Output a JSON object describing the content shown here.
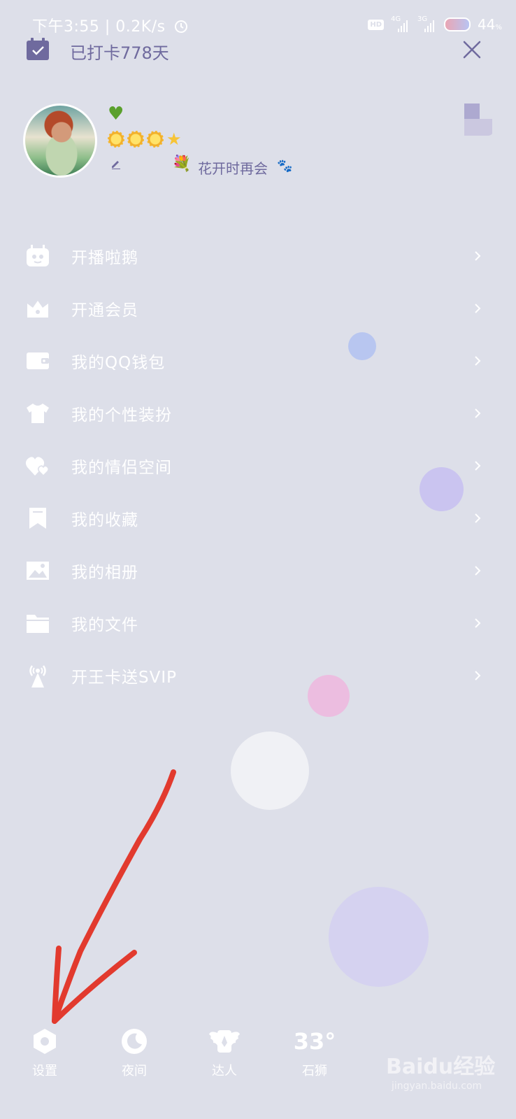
{
  "status_bar": {
    "left": "下午3:55 | 0.2K/s",
    "alarm_icon": "alarm-icon",
    "hd": "HD",
    "net1": "4G",
    "net2": "3G",
    "battery": "44",
    "battery_unit": "%"
  },
  "header": {
    "checkin": "已打卡778天"
  },
  "profile": {
    "signature": "花开时再会"
  },
  "menu": [
    {
      "label": "开播啦鹅",
      "icon": "tv-robot-icon"
    },
    {
      "label": "开通会员",
      "icon": "crown-icon"
    },
    {
      "label": "我的QQ钱包",
      "icon": "wallet-icon"
    },
    {
      "label": "我的个性装扮",
      "icon": "tshirt-icon"
    },
    {
      "label": "我的情侣空间",
      "icon": "hearts-icon"
    },
    {
      "label": "我的收藏",
      "icon": "bookmark-icon"
    },
    {
      "label": "我的相册",
      "icon": "photo-icon"
    },
    {
      "label": "我的文件",
      "icon": "folder-icon"
    },
    {
      "label": "开王卡送SVIP",
      "icon": "signal-tower-icon"
    }
  ],
  "bottom": {
    "settings": "设置",
    "night": "夜间",
    "expert": "达人",
    "temperature": "33°",
    "city": "石狮"
  },
  "watermark": {
    "logo": "Baidu经验",
    "url": "jingyan.baidu.com"
  },
  "colors": {
    "background": "#dddfe9",
    "accent_text": "#6f6a9e",
    "annotation_arrow": "#e23a2e"
  }
}
